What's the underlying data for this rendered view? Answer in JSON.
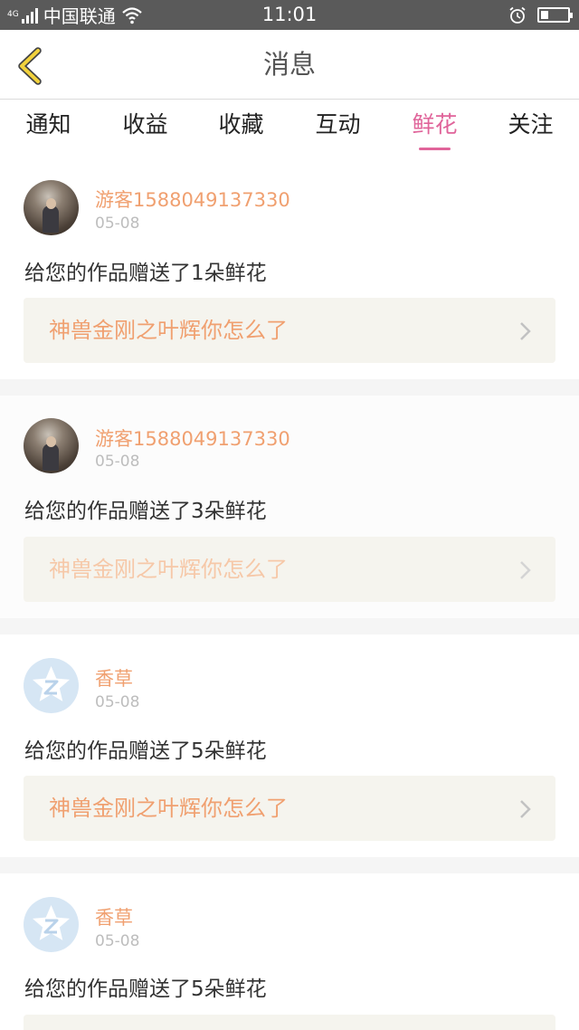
{
  "status_bar": {
    "net_type": "4G",
    "carrier": "中国联通",
    "time": "11:01",
    "battery_level": 0.3
  },
  "header": {
    "title": "消息"
  },
  "tabs": [
    {
      "label": "通知",
      "active": false
    },
    {
      "label": "收益",
      "active": false
    },
    {
      "label": "收藏",
      "active": false
    },
    {
      "label": "互动",
      "active": false
    },
    {
      "label": "鲜花",
      "active": true
    },
    {
      "label": "关注",
      "active": false
    }
  ],
  "messages": [
    {
      "name": "游客1588049137330",
      "date": "05-08",
      "avatar": "photo",
      "text": "给您的作品赠送了1朵鲜花",
      "link": "神兽金刚之叶辉你怎么了"
    },
    {
      "name": "游客1588049137330",
      "date": "05-08",
      "avatar": "photo",
      "text": "给您的作品赠送了3朵鲜花",
      "link": "神兽金刚之叶辉你怎么了"
    },
    {
      "name": "香草",
      "date": "05-08",
      "avatar": "qq-default-icon",
      "text": "给您的作品赠送了5朵鲜花",
      "link": "神兽金刚之叶辉你怎么了"
    },
    {
      "name": "香草",
      "date": "05-08",
      "avatar": "qq-default-icon",
      "text": "给您的作品赠送了5朵鲜花",
      "link": ""
    }
  ],
  "colors": {
    "accent": "#e0649a",
    "name": "#f0a070",
    "back_icon": "#f2d23c"
  }
}
